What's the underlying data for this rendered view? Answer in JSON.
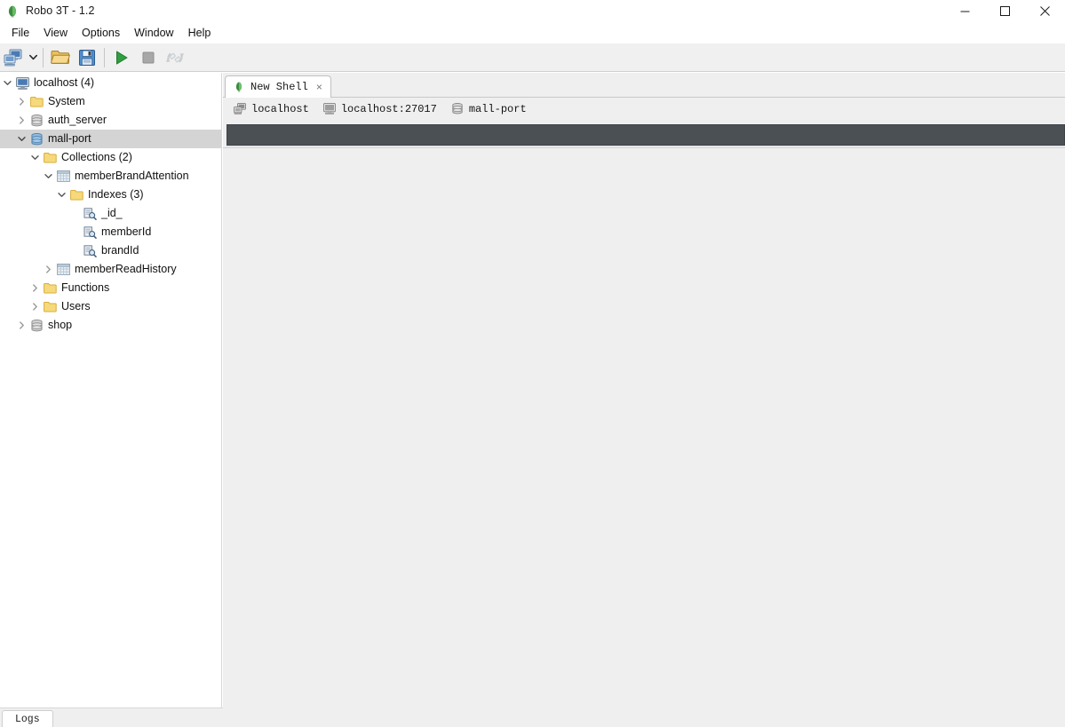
{
  "window": {
    "title": "Robo 3T - 1.2",
    "app_icon": "mongodb-leaf-icon",
    "controls": {
      "minimize": "minimize-icon",
      "maximize": "maximize-icon",
      "close": "close-icon"
    }
  },
  "menubar": {
    "items": [
      {
        "label": "File"
      },
      {
        "label": "View"
      },
      {
        "label": "Options"
      },
      {
        "label": "Window"
      },
      {
        "label": "Help"
      }
    ]
  },
  "toolbar": {
    "buttons": [
      {
        "name": "connect-button",
        "icon": "computers-connect-icon",
        "enabled": true
      },
      {
        "name": "connect-dropdown",
        "icon": "chevron-down-icon",
        "enabled": true
      },
      {
        "name": "open-script-button",
        "icon": "open-folder-icon",
        "enabled": true
      },
      {
        "name": "save-script-button",
        "icon": "floppy-save-icon",
        "enabled": true
      },
      {
        "name": "execute-button",
        "icon": "play-triangle-icon",
        "enabled": true
      },
      {
        "name": "stop-button",
        "icon": "stop-square-icon",
        "enabled": true
      },
      {
        "name": "refresh-button",
        "icon": "rotate-refresh-icon",
        "enabled": false
      }
    ]
  },
  "sidebar": {
    "tree": [
      {
        "label": "localhost (4)",
        "icon": "server-monitor-icon",
        "indent": 0,
        "twisty": "expanded",
        "selected": false
      },
      {
        "label": "System",
        "icon": "folder-icon",
        "indent": 1,
        "twisty": "collapsed",
        "selected": false
      },
      {
        "label": "auth_server",
        "icon": "database-gray-icon",
        "indent": 1,
        "twisty": "collapsed",
        "selected": false
      },
      {
        "label": "mall-port",
        "icon": "database-blue-icon",
        "indent": 1,
        "twisty": "expanded",
        "selected": true
      },
      {
        "label": "Collections (2)",
        "icon": "folder-icon",
        "indent": 2,
        "twisty": "expanded",
        "selected": false
      },
      {
        "label": "memberBrandAttention",
        "icon": "collection-grid-icon",
        "indent": 3,
        "twisty": "expanded",
        "selected": false
      },
      {
        "label": "Indexes (3)",
        "icon": "folder-icon",
        "indent": 4,
        "twisty": "expanded",
        "selected": false
      },
      {
        "label": "_id_",
        "icon": "index-icon",
        "indent": 5,
        "twisty": "none",
        "selected": false
      },
      {
        "label": "memberId",
        "icon": "index-icon",
        "indent": 5,
        "twisty": "none",
        "selected": false
      },
      {
        "label": "brandId",
        "icon": "index-icon",
        "indent": 5,
        "twisty": "none",
        "selected": false
      },
      {
        "label": "memberReadHistory",
        "icon": "collection-grid-icon",
        "indent": 3,
        "twisty": "collapsed",
        "selected": false
      },
      {
        "label": "Functions",
        "icon": "folder-icon",
        "indent": 2,
        "twisty": "collapsed",
        "selected": false
      },
      {
        "label": "Users",
        "icon": "folder-icon",
        "indent": 2,
        "twisty": "collapsed",
        "selected": false
      },
      {
        "label": "shop",
        "icon": "database-gray-icon",
        "indent": 1,
        "twisty": "collapsed",
        "selected": false
      }
    ]
  },
  "main": {
    "tabs": [
      {
        "label": "New Shell",
        "icon": "mongodb-leaf-icon",
        "close": "×",
        "active": true
      }
    ],
    "shell_info": [
      {
        "label": "localhost",
        "icon": "servers-icon"
      },
      {
        "label": "localhost:27017",
        "icon": "monitor-icon"
      },
      {
        "label": "mall-port",
        "icon": "database-gray-icon"
      }
    ],
    "editor": {
      "value": "",
      "placeholder": ""
    }
  },
  "bottom_dock": {
    "tabs": [
      {
        "label": "Logs",
        "active": true
      }
    ]
  },
  "colors": {
    "titlebar_bg": "#ffffff",
    "toolbar_bg": "#f0f0f0",
    "sidebar_bg": "#ffffff",
    "selection_bg": "#d4d4d4",
    "main_bg": "#efefef",
    "editor_bg": "#4b5055",
    "accent_green": "#3f9c35",
    "folder_yellow": "#f5d97b",
    "database_blue": "#6aa5d4"
  }
}
